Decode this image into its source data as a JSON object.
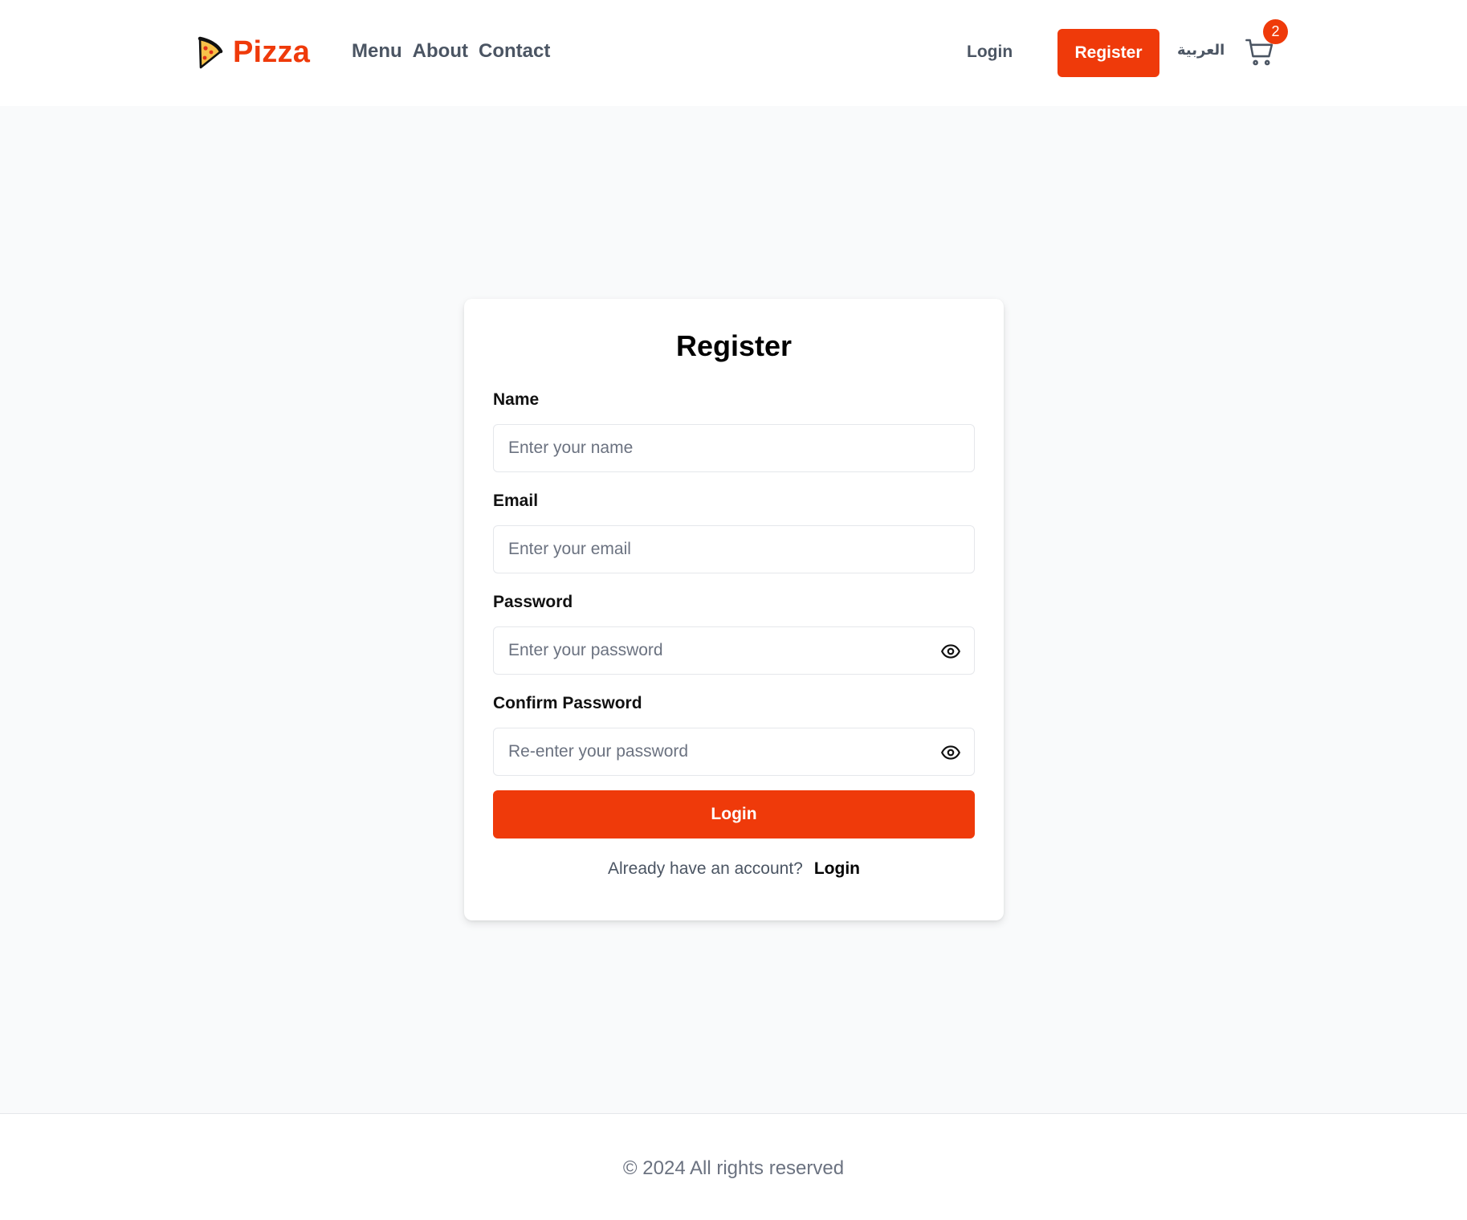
{
  "header": {
    "logo_icon": "pizza-slice-icon",
    "brand": "Pizza",
    "nav": [
      {
        "label": "Menu"
      },
      {
        "label": "About"
      },
      {
        "label": "Contact"
      }
    ],
    "login_label": "Login",
    "register_label": "Register",
    "language_label": "العربية",
    "cart_icon": "shopping-cart-icon",
    "cart_count": "2"
  },
  "form": {
    "title": "Register",
    "fields": [
      {
        "label": "Name",
        "placeholder": "Enter your name",
        "value": "",
        "type": "text"
      },
      {
        "label": "Email",
        "placeholder": "Enter your email",
        "value": "",
        "type": "email"
      },
      {
        "label": "Password",
        "placeholder": "Enter your password",
        "value": "",
        "type": "password",
        "icon": "eye-icon"
      },
      {
        "label": "Confirm Password",
        "placeholder": "Re-enter your password",
        "value": "",
        "type": "password",
        "icon": "eye-icon"
      }
    ],
    "submit_label": "Login",
    "switch_text": "Already have an account?",
    "switch_link": "Login"
  },
  "footer": {
    "copyright": "© 2024 All rights reserved"
  },
  "colors": {
    "accent": "#ef3a0a",
    "background": "#f9fafb",
    "nav_text": "#4b5563",
    "placeholder": "#6b7280"
  }
}
